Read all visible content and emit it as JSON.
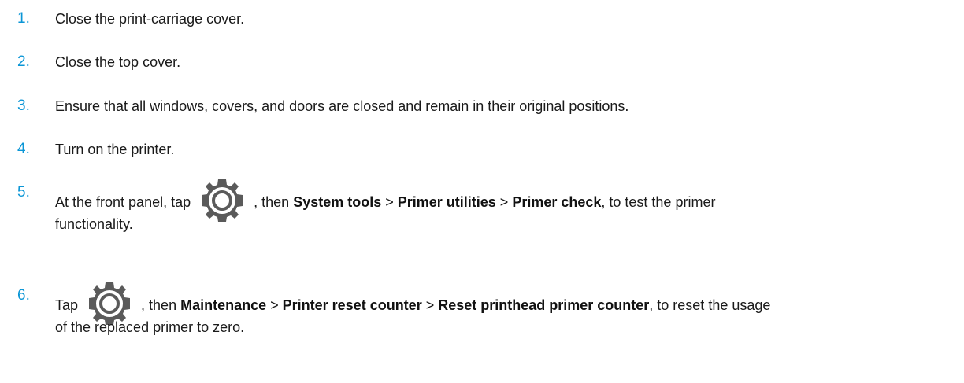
{
  "steps": [
    {
      "number": "1.",
      "text": "Close the print-carriage cover."
    },
    {
      "number": "2.",
      "text": "Close the top cover."
    },
    {
      "number": "3.",
      "text": "Ensure that all windows, covers, and doors are closed and remain in their original positions."
    },
    {
      "number": "4.",
      "text": "Turn on the printer."
    },
    {
      "number": "5.",
      "pre": "At the front panel, tap",
      "mid": ", then",
      "path": [
        "System tools",
        "Primer utilities",
        "Primer check"
      ],
      "sep": " > ",
      "post": ", to test the primer",
      "cont": "functionality."
    },
    {
      "number": "6.",
      "pre": "Tap",
      "mid": ", then",
      "path": [
        "Maintenance",
        "Printer reset counter",
        "Reset printhead primer counter"
      ],
      "sep": " > ",
      "post": ", to reset the usage",
      "cont": "of the replaced primer to zero."
    }
  ],
  "icons": {
    "settings": "gear-icon"
  },
  "colors": {
    "step_number": "#0b96d6",
    "gear": "#5a5a5a"
  }
}
